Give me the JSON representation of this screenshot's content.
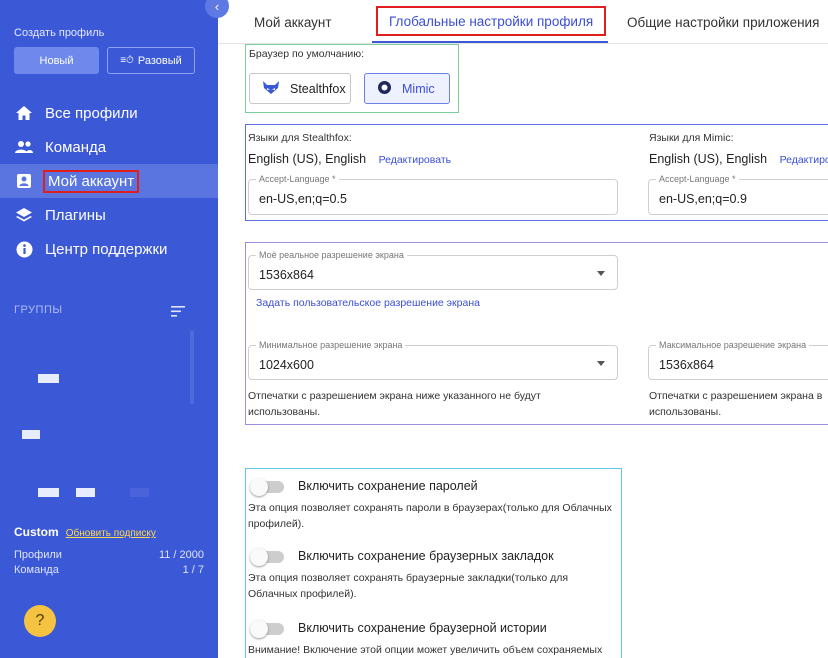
{
  "sidebar": {
    "create_title": "Создать профиль",
    "new_button": "Новый",
    "onetime_button": "Разовый",
    "nav": [
      {
        "label": "Все профили",
        "icon": "home-icon"
      },
      {
        "label": "Команда",
        "icon": "team-icon"
      },
      {
        "label": "Мой аккаунт",
        "icon": "account-icon",
        "active": true
      },
      {
        "label": "Плагины",
        "icon": "layers-icon"
      },
      {
        "label": "Центр поддержки",
        "icon": "info-icon"
      }
    ],
    "groups_title": "ГРУППЫ",
    "plan": {
      "name": "Custom",
      "upgrade_link": "Обновить подписку",
      "profiles_label": "Профили",
      "profiles_value": "11 / 2000",
      "team_label": "Команда",
      "team_value": "1 / 7"
    },
    "help_icon": "?"
  },
  "tabs": [
    {
      "label": "Мой аккаунт"
    },
    {
      "label": "Глобальные настройки профиля",
      "active": true
    },
    {
      "label": "Общие настройки приложения"
    }
  ],
  "browser": {
    "title": "Браузер по умолчанию:",
    "stealthfox": "Stealthfox",
    "mimic": "Mimic",
    "selected": "Mimic"
  },
  "languages": {
    "stealthfox_label": "Языки для Stealthfox:",
    "stealthfox_value": "English (US), English",
    "mimic_label": "Языки для Mimic:",
    "mimic_value": "English (US), English",
    "edit_link": "Редактировать",
    "edit_link_cut": "Редактиро",
    "accept_label": "Accept-Language *",
    "stealthfox_accept": "en-US,en;q=0.5",
    "mimic_accept": "en-US,en;q=0.9"
  },
  "resolution": {
    "real_label": "Моё реальное разрешение экрана",
    "real_value": "1536x864",
    "custom_link": "Задать пользовательское разрешение экрана",
    "min_label": "Минимальное разрешение экрана",
    "min_value": "1024x600",
    "max_label": "Максимальное разрешение экрана",
    "max_value": "1536x864",
    "min_note": "Отпечатки с разрешением экрана ниже указанного не будут использованы.",
    "max_note_l1": "Отпечатки с разрешением экрана в",
    "max_note_l2": "использованы."
  },
  "toggles": {
    "passwords_label": "Включить сохранение паролей",
    "passwords_desc": "Эта опция позволяет сохранять пароли в браузерах(только для Облачных профилей).",
    "bookmarks_label": "Включить сохранение браузерных закладок",
    "bookmarks_desc": "Эта опция позволяет сохранять браузерные закладки(только для Облачных профилей).",
    "history_label": "Включить сохранение браузерной истории",
    "history_desc": "Внимание! Включение этой опции может увеличить объем сохраняемых"
  },
  "colors": {
    "sidebar": "#3b58d6",
    "accent": "#3b4ed6",
    "highlight_red": "#e01e1e",
    "browser_box": "#7ccf9a",
    "lang_box": "#5b70e0",
    "res_box": "#9a8ee0",
    "toggles_box": "#5ec8e8"
  }
}
